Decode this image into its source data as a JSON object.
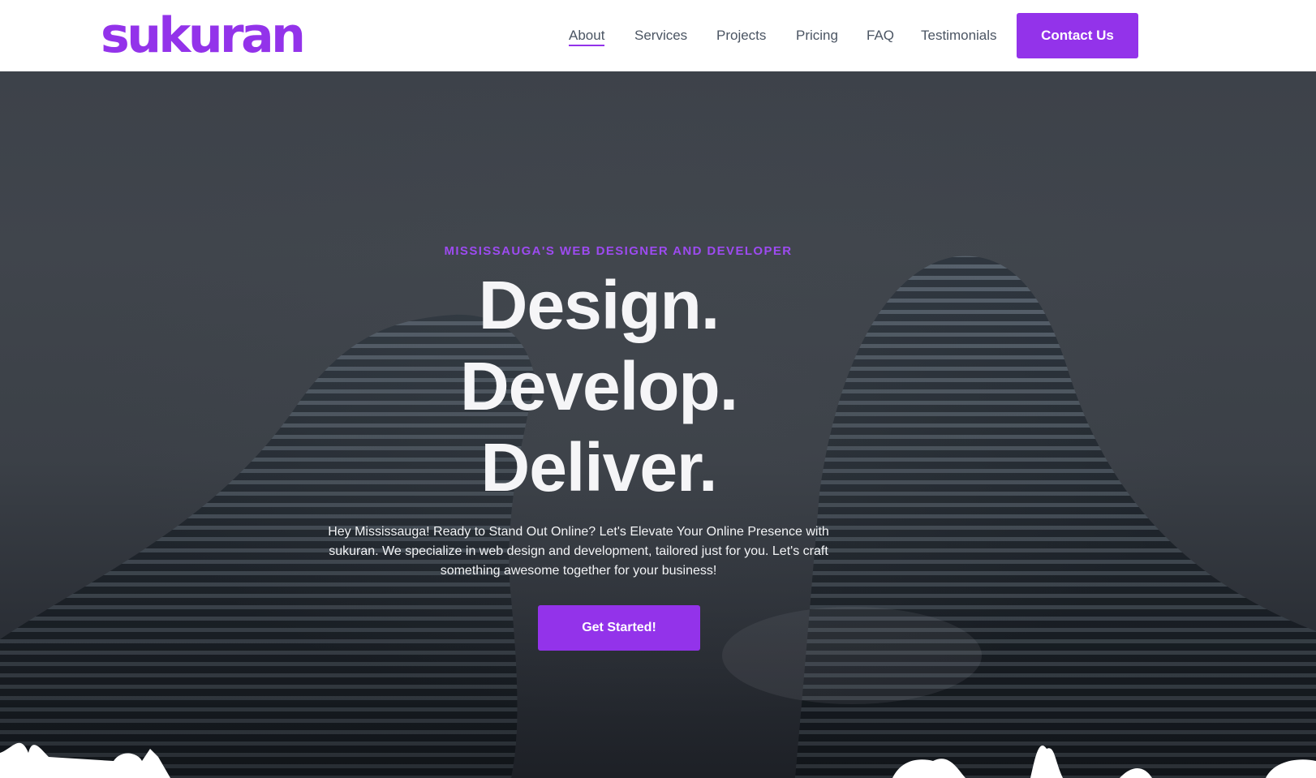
{
  "brand": {
    "logo_text": "sukuran",
    "accent_color": "#9333ea"
  },
  "nav": {
    "items": [
      {
        "label": "About",
        "active": true
      },
      {
        "label": "Services",
        "active": false
      },
      {
        "label": "Projects",
        "active": false
      },
      {
        "label": "Pricing",
        "active": false
      },
      {
        "label": "FAQ",
        "active": false
      },
      {
        "label": "Testimonials",
        "active": false
      }
    ],
    "contact_label": "Contact Us"
  },
  "hero": {
    "eyebrow": "MISSISSAUGA'S WEB DESIGNER AND DEVELOPER",
    "headline": [
      "Design.",
      "Develop.",
      "Deliver."
    ],
    "description": "Hey Mississauga! Ready to Stand Out Online? Let's Elevate Your Online Presence with sukuran. We specialize in web design and development, tailored just for you. Let's craft something awesome together for your business!",
    "cta_label": "Get Started!",
    "background_image": "twin curved skyscrapers viewed from below"
  }
}
